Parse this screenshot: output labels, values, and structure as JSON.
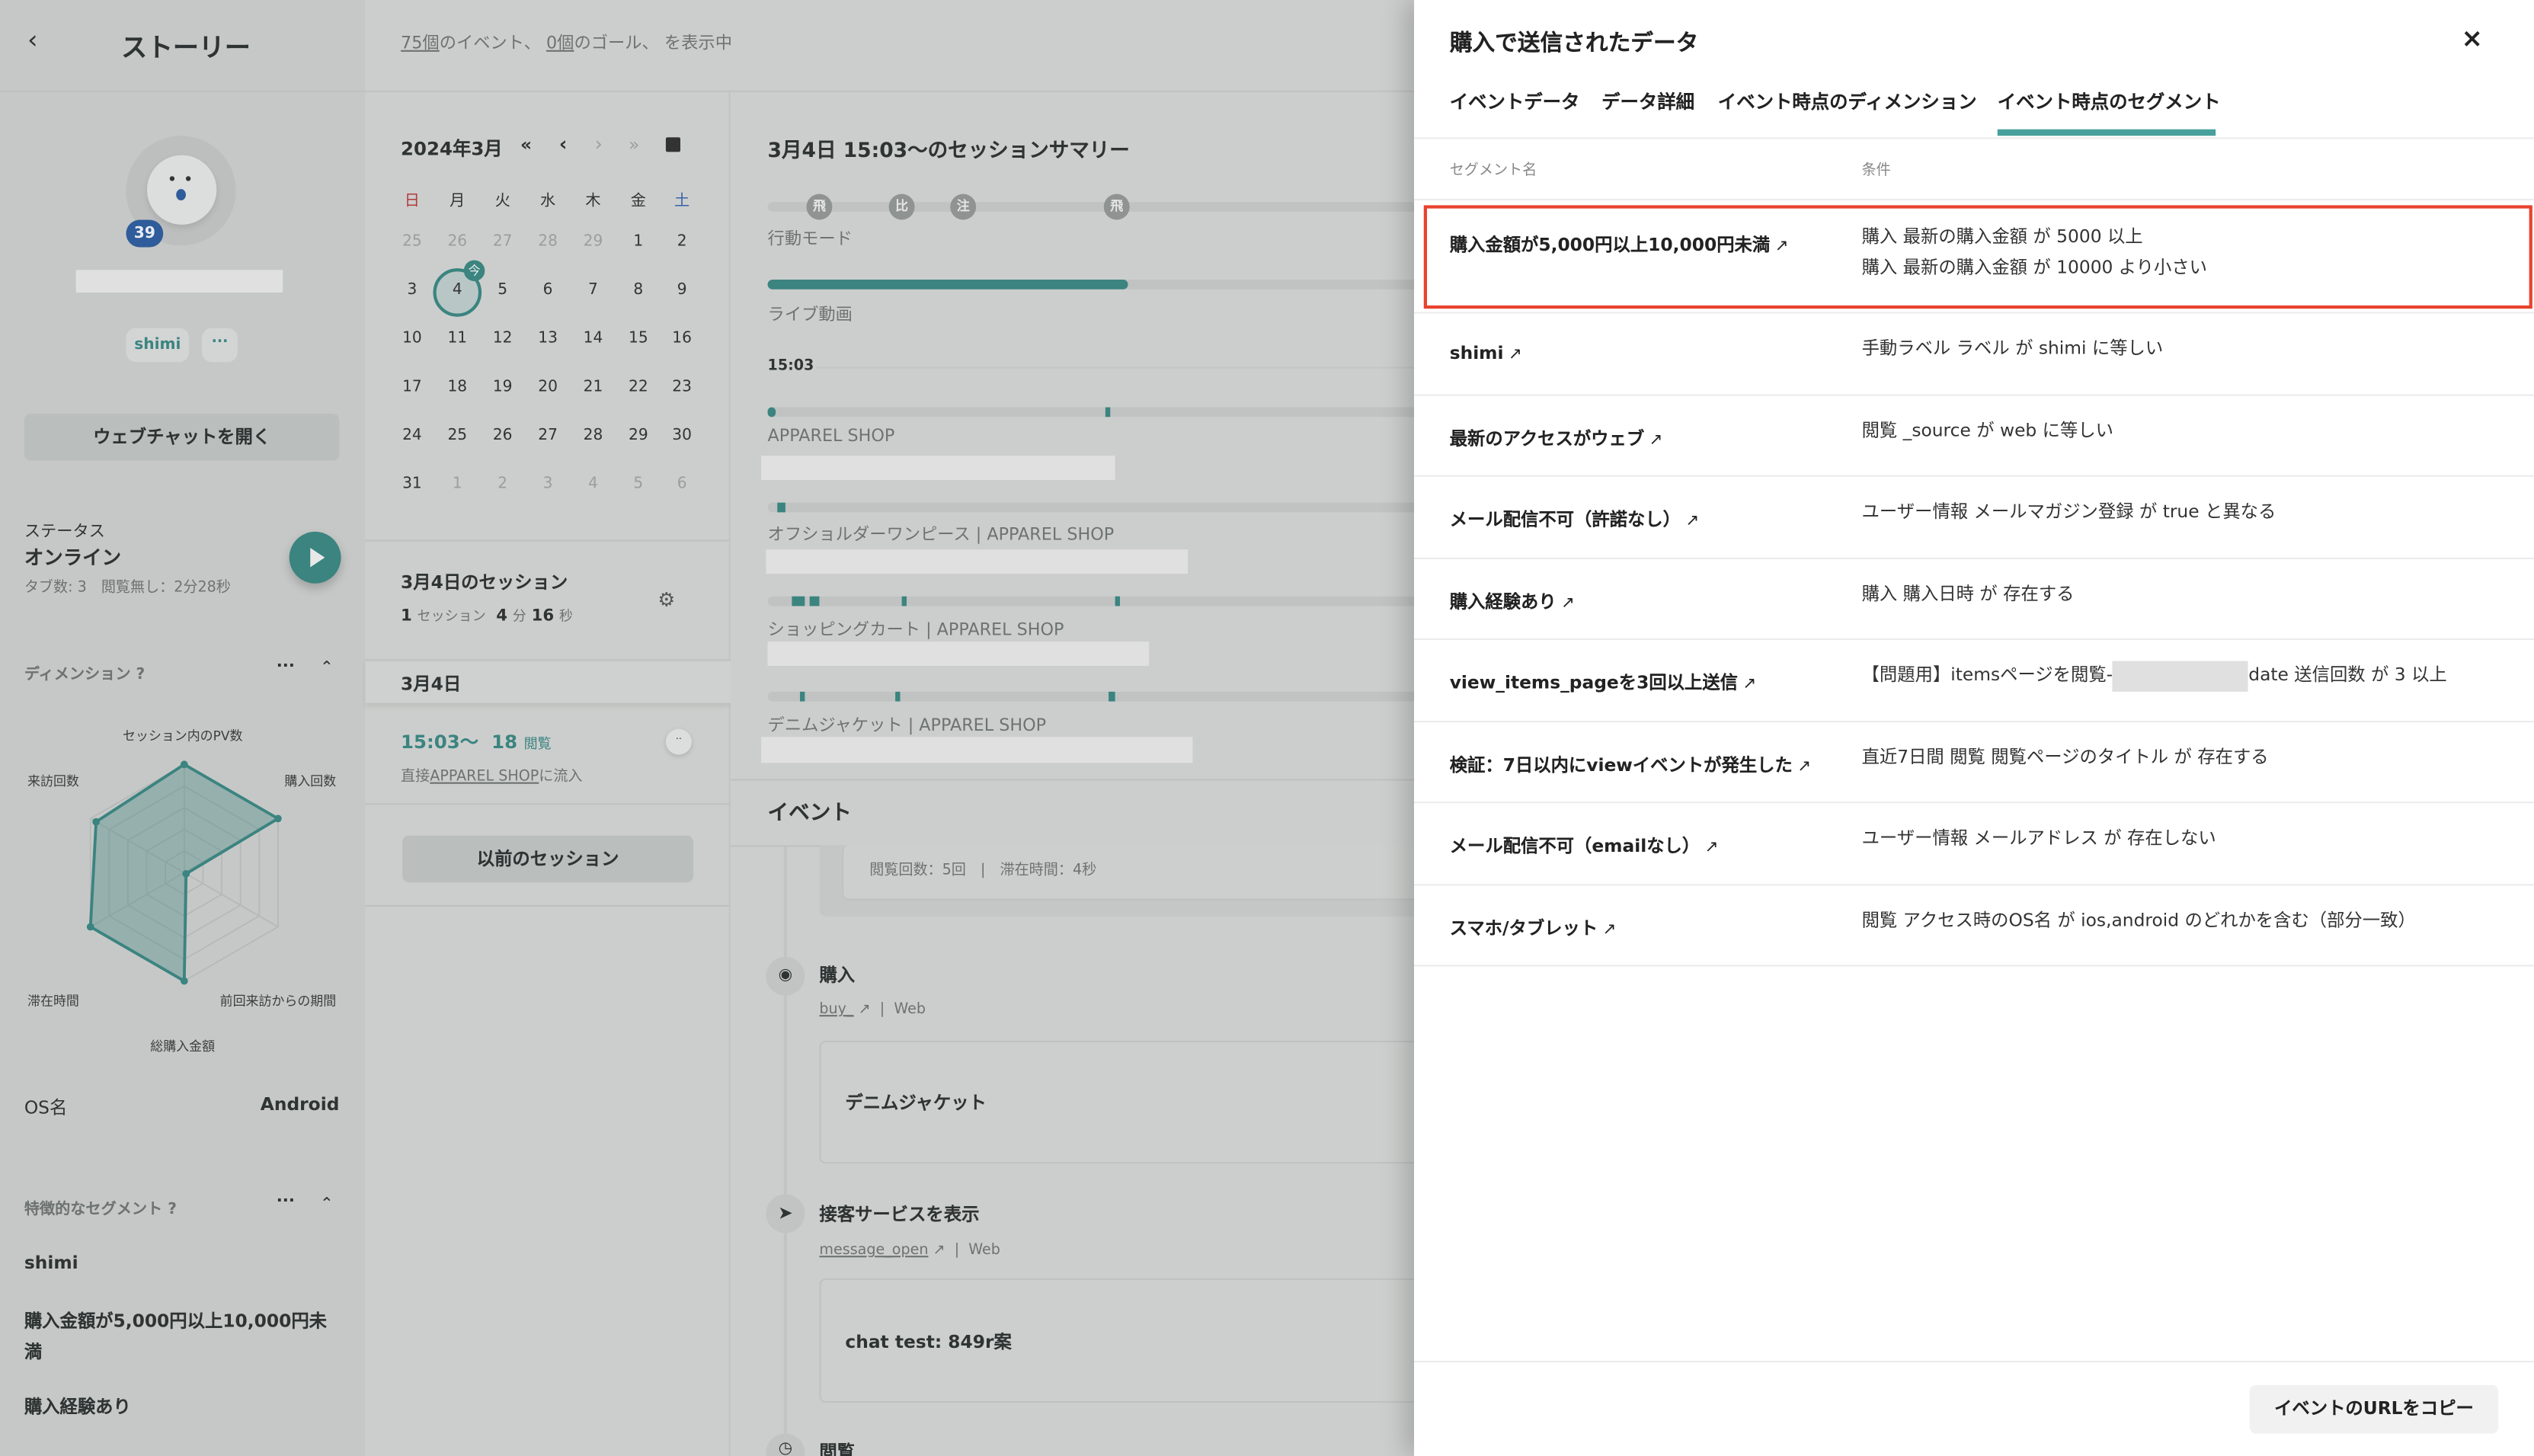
{
  "sidebar": {
    "back_icon": "chevron-left-icon",
    "title": "ストーリー",
    "badge_count": "39",
    "chips": [
      "shimi",
      "···"
    ],
    "open_chat_label": "ウェブチャットを開く",
    "status_label": "ステータス",
    "status_value": "オンライン",
    "status_detail": "タブ数: 3　閲覧無し：2分28秒",
    "dimensions_title": "ディメンション",
    "more_label": "···",
    "radar": {
      "axes": [
        "セッション内のPV数",
        "購入回数",
        "前回来訪からの期間",
        "総購入金額",
        "滞在時間",
        "来訪回数"
      ],
      "values": [
        5,
        5,
        0.1,
        5,
        5,
        4.7
      ],
      "max": 5
    },
    "os_label": "OS名",
    "os_value": "Android",
    "segments_title": "特徴的なセグメント",
    "segments": [
      "shimi",
      "購入金額が5,000円以上10,000円未満",
      "購入経験あり"
    ]
  },
  "topbar": {
    "events_count": "75個",
    "events_text": "のイベント、",
    "goals_count": "0個",
    "goals_text": "のゴール、 を表示中"
  },
  "calendar": {
    "month": "2024年3月",
    "nav": [
      "«",
      "‹",
      "›",
      "»"
    ],
    "weekdays": [
      "日",
      "月",
      "火",
      "水",
      "木",
      "金",
      "土"
    ],
    "weeks": [
      [
        "25",
        "26",
        "27",
        "28",
        "29",
        "1",
        "2"
      ],
      [
        "3",
        "4",
        "5",
        "6",
        "7",
        "8",
        "9"
      ],
      [
        "10",
        "11",
        "12",
        "13",
        "14",
        "15",
        "16"
      ],
      [
        "17",
        "18",
        "19",
        "20",
        "21",
        "22",
        "23"
      ],
      [
        "24",
        "25",
        "26",
        "27",
        "28",
        "29",
        "30"
      ],
      [
        "31",
        "1",
        "2",
        "3",
        "4",
        "5",
        "6"
      ]
    ],
    "today_badge": "今",
    "colors": {
      "sunday": "#b23a3a",
      "saturday": "#3a62a8",
      "accent": "#3b8480"
    }
  },
  "sessions": {
    "title": "3月4日のセッション",
    "count": "1",
    "count_unit": "セッション",
    "min": "4",
    "min_unit": "分",
    "sec": "16",
    "sec_unit": "秒",
    "date_header": "3月4日",
    "item_time": "15:03〜",
    "item_views": "18",
    "item_views_unit": "閲覧",
    "item_source_prefix": "直接",
    "item_source_link": "APPAREL SHOP",
    "item_source_suffix": "に流入",
    "prev_button": "以前のセッション"
  },
  "summary": {
    "title": "3月4日 15:03〜のセッションサマリー",
    "mode_icons": [
      "飛",
      "比",
      "注",
      "飛"
    ],
    "mode_label": "行動モード",
    "live_label": "ライブ動画",
    "live_progress": 0.53,
    "time_label": "15:03",
    "pages": [
      "APPAREL SHOP",
      "オフショルダーワンピース | APPAREL SHOP",
      "ショッピングカート | APPAREL SHOP",
      "デニムジャケット | APPAREL SHOP"
    ]
  },
  "events": {
    "title": "イベント",
    "partial_card": "閲覧回数：5回　|　滞在時間：4秒",
    "items": [
      {
        "icon": "eye-icon",
        "title": "購入",
        "link": "buy_",
        "channel": "Web",
        "content": "デニムジャケット"
      },
      {
        "icon": "paper-plane-icon",
        "title": "接客サービスを表示",
        "link": "message_open",
        "channel": "Web",
        "content": "chat test: 849r案"
      },
      {
        "icon": "clock-icon",
        "title": "閲覧"
      }
    ]
  },
  "panel": {
    "title": "購入で送信されたデータ",
    "close": "×",
    "tabs": [
      "イベントデータ",
      "データ詳細",
      "イベント時点のディメンション",
      "イベント時点のセグメント"
    ],
    "active_tab": 3,
    "col_name": "セグメント名",
    "col_condition": "条件",
    "rows": [
      {
        "name": "購入金額が5,000円以上10,000円未満",
        "cond": [
          "購入 最新の購入金額 が 5000 以上",
          "購入 最新の購入金額 が 10000 より小さい"
        ],
        "highlighted": true
      },
      {
        "name": "shimi",
        "cond": [
          "手動ラベル ラベル が shimi に等しい"
        ]
      },
      {
        "name": "最新のアクセスがウェブ",
        "cond": [
          "閲覧 _source が web に等しい"
        ]
      },
      {
        "name": "メール配信不可（許諾なし）",
        "cond": [
          "ユーザー情報 メールマガジン登録 が true と異なる"
        ]
      },
      {
        "name": "購入経験あり",
        "cond": [
          "購入 購入日時 が 存在する"
        ]
      },
      {
        "name": "view_items_pageを3回以上送信",
        "cond": [
          "【問題用】itemsページを閲覧-",
          "date 送信回数 が 3 以上"
        ],
        "redacted_middle": true
      },
      {
        "name": "検証：7日以内にviewイベントが発生した",
        "cond": [
          "直近7日間 閲覧 閲覧ページのタイトル が 存在する"
        ]
      },
      {
        "name": "メール配信不可（emailなし）",
        "cond": [
          "ユーザー情報 メールアドレス が 存在しない"
        ]
      },
      {
        "name": "スマホ/タブレット",
        "cond": [
          "閲覧 アクセス時のOS名 が ios,android のどれかを含む（部分一致）"
        ]
      }
    ],
    "copy_button": "イベントのURLをコピー",
    "colors": {
      "accent": "#47a09b",
      "highlight": "#e8432e"
    }
  }
}
